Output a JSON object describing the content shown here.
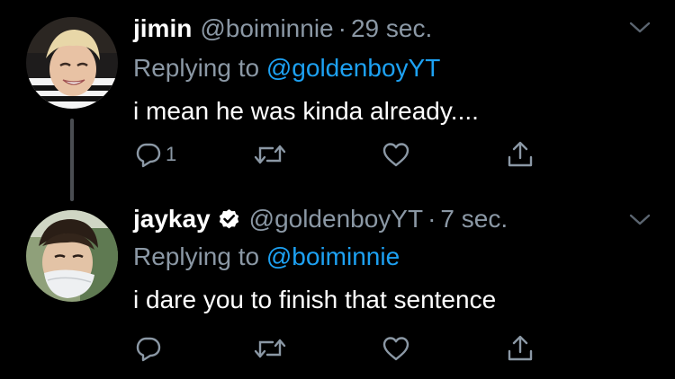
{
  "thread": {
    "tweets": [
      {
        "display_name": "jimin",
        "handle": "@boiminnie",
        "separator": "·",
        "time": "29 sec.",
        "replying_prefix": "Replying to",
        "replying_to": "@goldenboyYT",
        "text": "i mean he was kinda already....",
        "reply_count": "1",
        "verified": false
      },
      {
        "display_name": "jaykay",
        "handle": "@goldenboyYT",
        "separator": "·",
        "time": "7 sec.",
        "replying_prefix": "Replying to",
        "replying_to": "@boiminnie",
        "text": "i dare you to finish that sentence",
        "reply_count": "",
        "verified": true
      }
    ]
  },
  "colors": {
    "background": "#000000",
    "text": "#ffffff",
    "muted": "#8b98a5",
    "link": "#1da1f2",
    "thread_line": "#4a4d52"
  },
  "icons": {
    "more": "chevron-down-icon",
    "reply": "reply-bubble-icon",
    "retweet": "retweet-icon",
    "like": "heart-icon",
    "share": "share-icon",
    "verified": "verified-badge-icon"
  }
}
